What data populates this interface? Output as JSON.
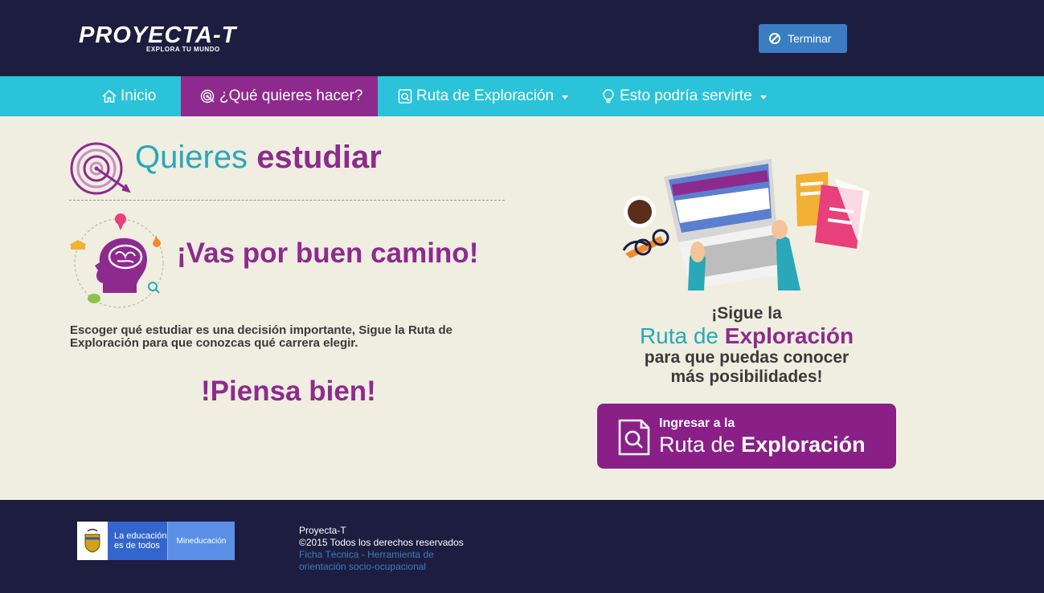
{
  "header": {
    "logo_text": "PROYECTA-T",
    "logo_tagline": "EXPLORA TU MUNDO",
    "end_button": "Terminar"
  },
  "nav": {
    "items": [
      {
        "label": "Inicio",
        "icon": "home-icon"
      },
      {
        "label": "¿Qué quieres hacer?",
        "icon": "target-icon"
      },
      {
        "label": "Ruta de Exploración",
        "icon": "document-search-icon"
      },
      {
        "label": "Esto podría servirte",
        "icon": "lightbulb-icon"
      }
    ]
  },
  "main": {
    "title_part1": "Quieres",
    "title_part2": "estudiar",
    "subheading": "¡Vas por buen camino!",
    "paragraph": "Escoger qué estudiar es una decisión importante, Sigue la Ruta de Exploración para que conozcas qué carrera elegir.",
    "closing": "!Piensa bien!"
  },
  "aside": {
    "line1": "¡Sigue la",
    "line2_part1": "Ruta de",
    "line2_part2": "Exploración",
    "line3": "para que puedas conocer",
    "line4": "más posibilidades!",
    "button_line1": "Ingresar a la",
    "button_line2_part1": "Ruta de",
    "button_line2_part2": "Exploración"
  },
  "footer": {
    "gov_text_line1": "La educación",
    "gov_text_line2": "es de todos",
    "gov_ministry": "Mineducación",
    "site_name": "Proyecta-T",
    "copyright": "©2015 Todos los derechos reservados",
    "link_label": "Ficha Técnica - Herramienta de orientación socio-ocupacional"
  },
  "colors": {
    "dark_navy": "#1d1d40",
    "cyan": "#2ac3d9",
    "purple": "#8e2a8e",
    "teal_text": "#2aa7b8",
    "button_blue": "#3a7dc2",
    "background": "#efeee0"
  }
}
